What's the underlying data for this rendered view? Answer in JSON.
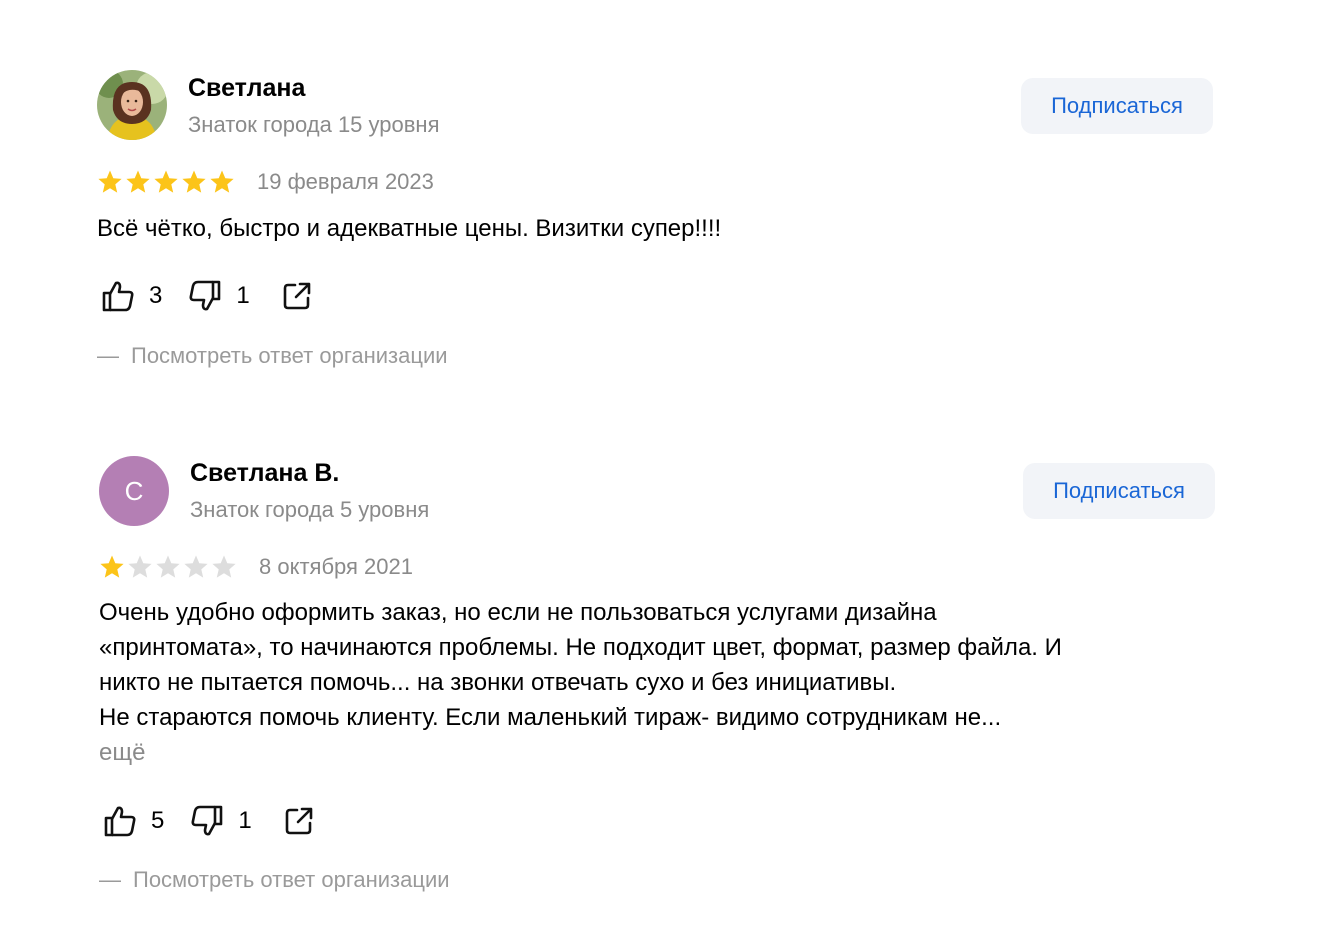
{
  "reviews": [
    {
      "author": {
        "name": "Светлана",
        "level": "Знаток города 15 уровня",
        "avatar_type": "photo"
      },
      "subscribe_label": "Подписаться",
      "rating": 5,
      "rating_max": 5,
      "date": "19 февраля 2023",
      "text_lines": [
        "Всё чётко, быстро и адекватные цены. Визитки супер!!!!"
      ],
      "more_label": "",
      "likes": "3",
      "dislikes": "1",
      "org_reply": {
        "dash": "—",
        "label": "Посмотреть ответ организации"
      }
    },
    {
      "author": {
        "name": "Светлана В.",
        "level": "Знаток города 5 уровня",
        "avatar_letter": "С",
        "avatar_color": "#b47fb4"
      },
      "subscribe_label": "Подписаться",
      "rating": 1,
      "rating_max": 5,
      "date": "8 октября 2021",
      "text_lines": [
        "Очень удобно оформить заказ, но если не пользоваться услугами дизайна",
        "«принтомата», то начинаются проблемы. Не подходит цвет, формат, размер файла. И",
        "никто не пытается помочь... на звонки отвечать сухо и без инициативы.",
        "Не стараются помочь клиенту. Если маленький тираж- видимо сотрудникам не..."
      ],
      "more_label": "ещё",
      "likes": "5",
      "dislikes": "1",
      "org_reply": {
        "dash": "—",
        "label": "Посмотреть ответ организации"
      }
    }
  ],
  "icons": {
    "like": "thumbs-up-icon",
    "dislike": "thumbs-down-icon",
    "share": "share-icon",
    "star": "star-icon"
  },
  "colors": {
    "star_filled": "#fcc419",
    "star_empty": "#dddddd",
    "link_blue": "#1a66d6",
    "button_bg": "#f2f4f8",
    "muted_text": "#8a8a8a"
  }
}
